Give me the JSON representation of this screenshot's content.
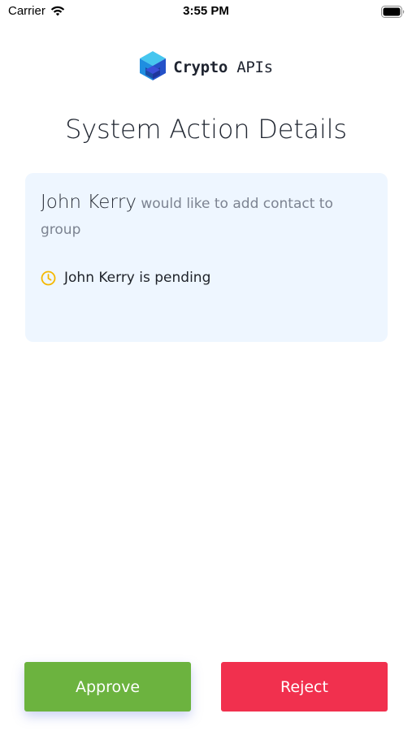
{
  "status_bar": {
    "carrier": "Carrier",
    "time": "3:55 PM"
  },
  "logo": {
    "bold": "Crypto",
    "light": " APIs"
  },
  "page": {
    "title": "System Action Details"
  },
  "card": {
    "name": "John Kerry",
    "action": " would like to add contact to group",
    "status_text": "John Kerry is pending",
    "status_icon": "clock-icon",
    "status_color": "#f5b800",
    "background": "#eef6ff"
  },
  "buttons": {
    "approve_label": "Approve",
    "reject_label": "Reject",
    "approve_color": "#6cb33f",
    "reject_color": "#f1304e"
  }
}
